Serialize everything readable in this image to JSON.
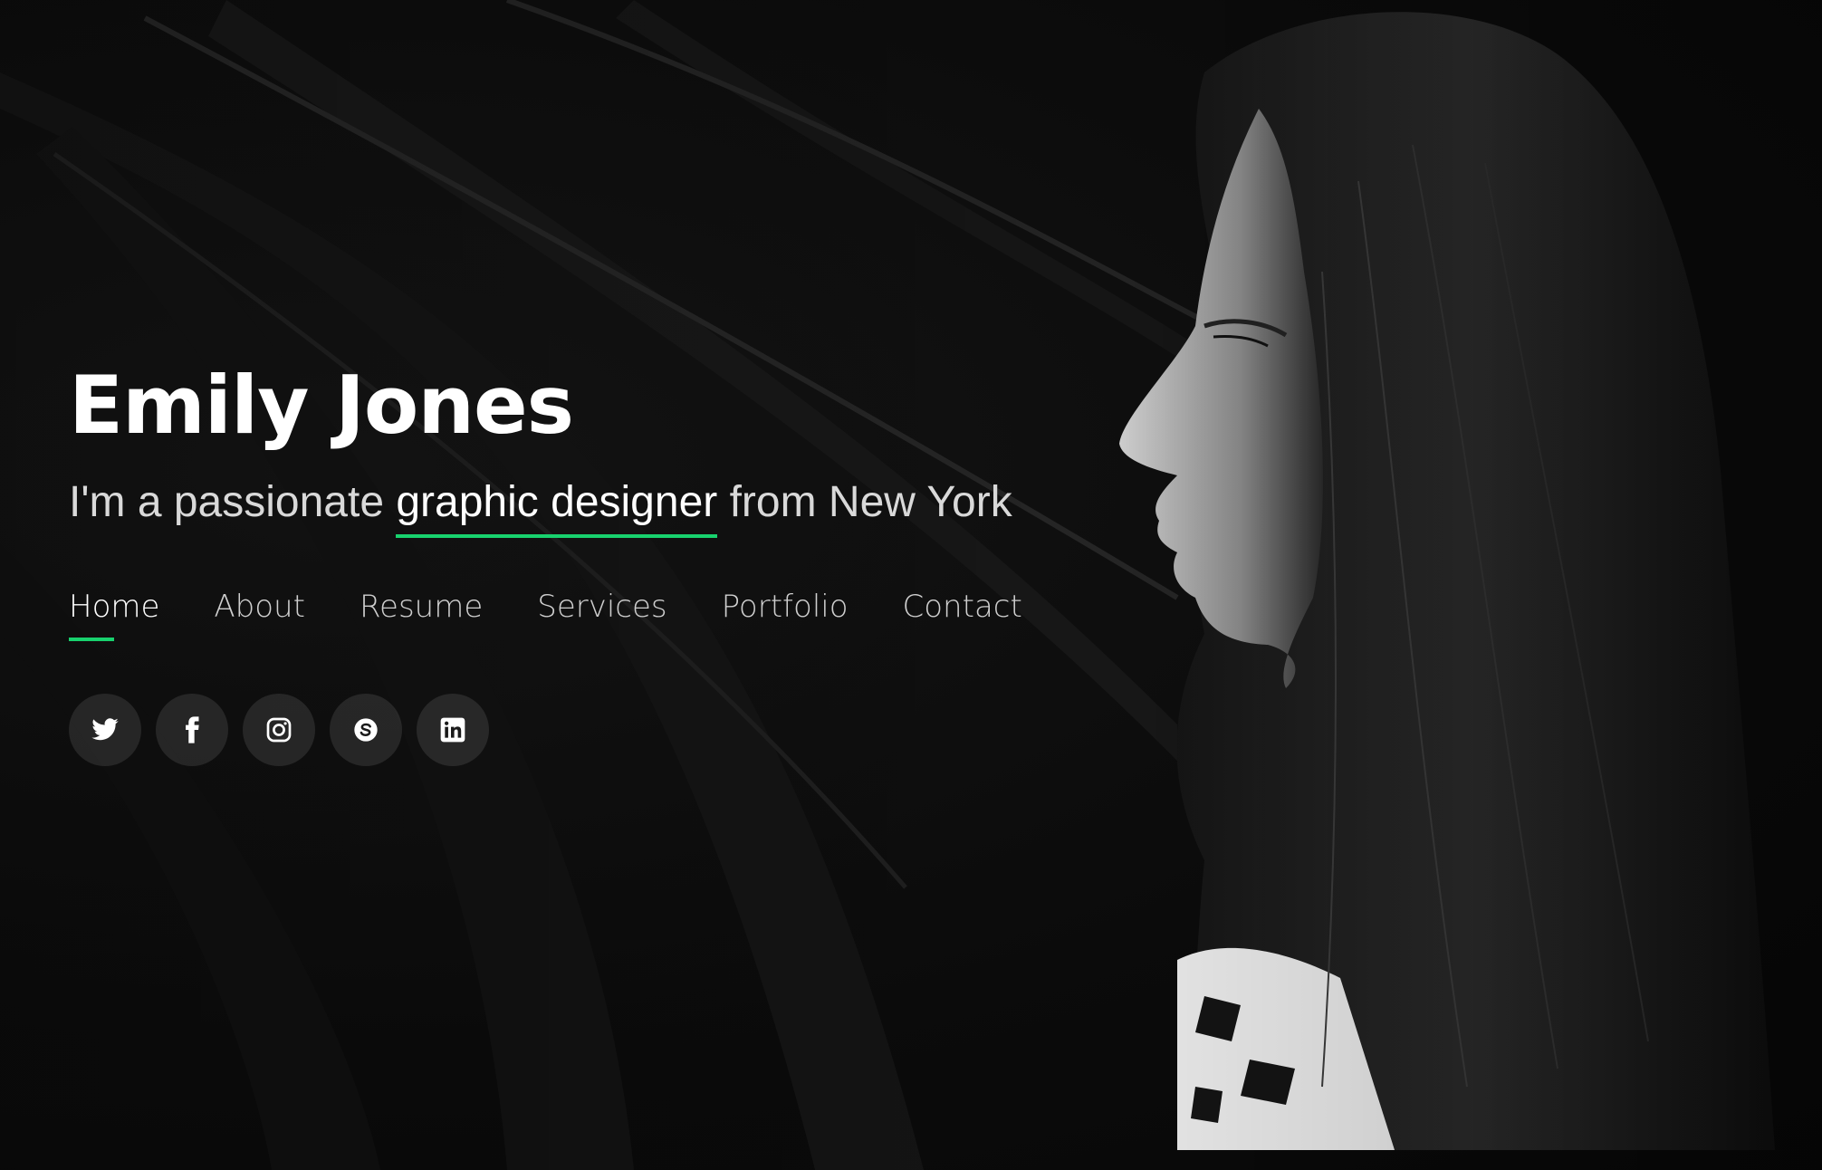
{
  "hero": {
    "name": "Emily Jones",
    "tagline_prefix": "I'm a passionate ",
    "tagline_highlight": "graphic designer",
    "tagline_suffix": " from New York",
    "accent_color": "#18d26e"
  },
  "nav": {
    "items": [
      {
        "label": "Home",
        "active": true
      },
      {
        "label": "About"
      },
      {
        "label": "Resume"
      },
      {
        "label": "Services"
      },
      {
        "label": "Portfolio"
      },
      {
        "label": "Contact"
      }
    ]
  },
  "social": {
    "icons": [
      "twitter-icon",
      "facebook-icon",
      "instagram-icon",
      "skype-icon",
      "linkedin-icon"
    ]
  }
}
